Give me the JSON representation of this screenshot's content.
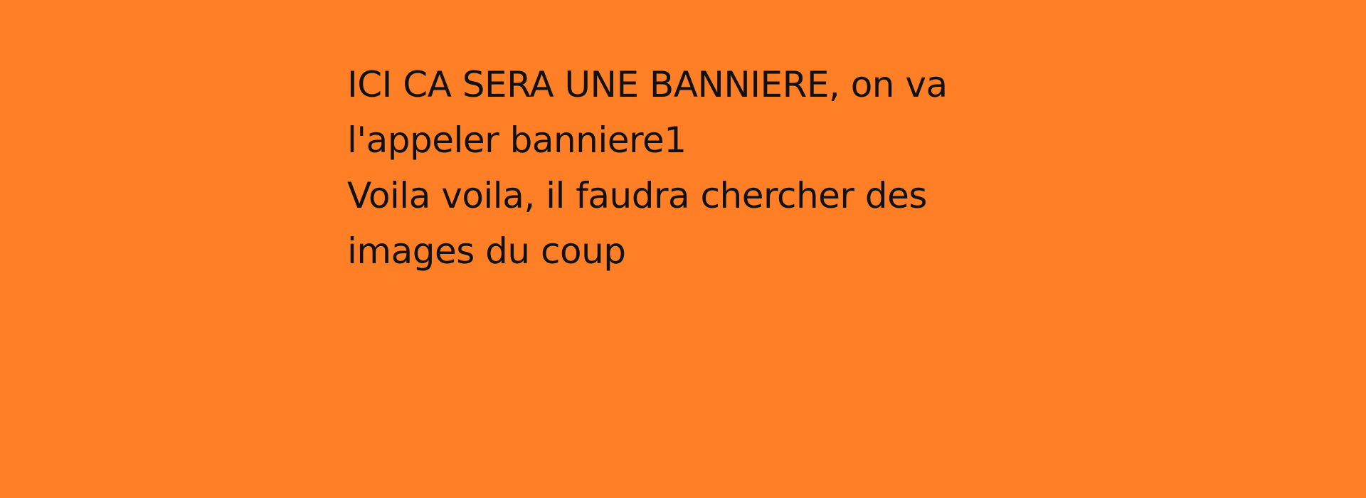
{
  "colors": {
    "background": "#FF7F27",
    "text": "#111111"
  },
  "banner": {
    "lines": [
      "ICI CA SERA UNE BANNIERE, on va",
      "l'appeler banniere1",
      "Voila voila, il faudra chercher des",
      "images du coup"
    ]
  }
}
